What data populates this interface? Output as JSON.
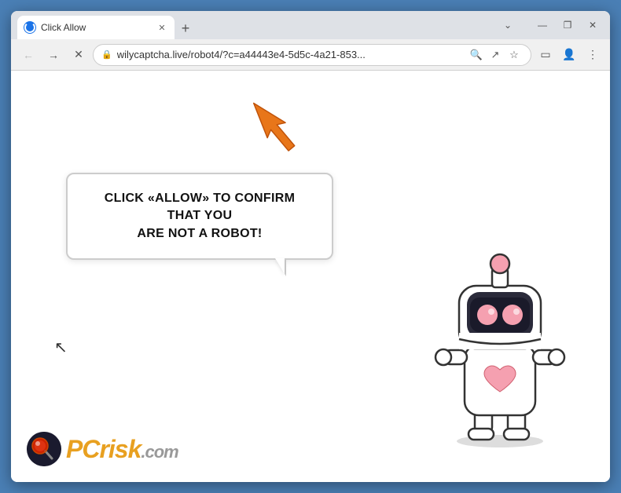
{
  "window": {
    "title": "Click Allow",
    "url": "wilycaptcha.live/robot4/?c=a44443e4-5d5c-4a21-853...",
    "url_full": "wilycaptcha.live/robot4/?c=a44443e4-5d5c-4a21-853..."
  },
  "tabs": [
    {
      "label": "Click Allow",
      "active": true
    }
  ],
  "buttons": {
    "back": "←",
    "forward": "→",
    "reload": "✕",
    "new_tab": "+",
    "minimize": "—",
    "maximize": "❐",
    "close": "✕",
    "chevron_down": "⌄"
  },
  "page": {
    "bubble_text_line1": "CLICK «ALLOW» TO CONFIRM THAT YOU",
    "bubble_text_line2": "ARE NOT A ROBOT!"
  },
  "logo": {
    "text_gray": "PC",
    "text_orange": "risk",
    "domain": ".com"
  }
}
